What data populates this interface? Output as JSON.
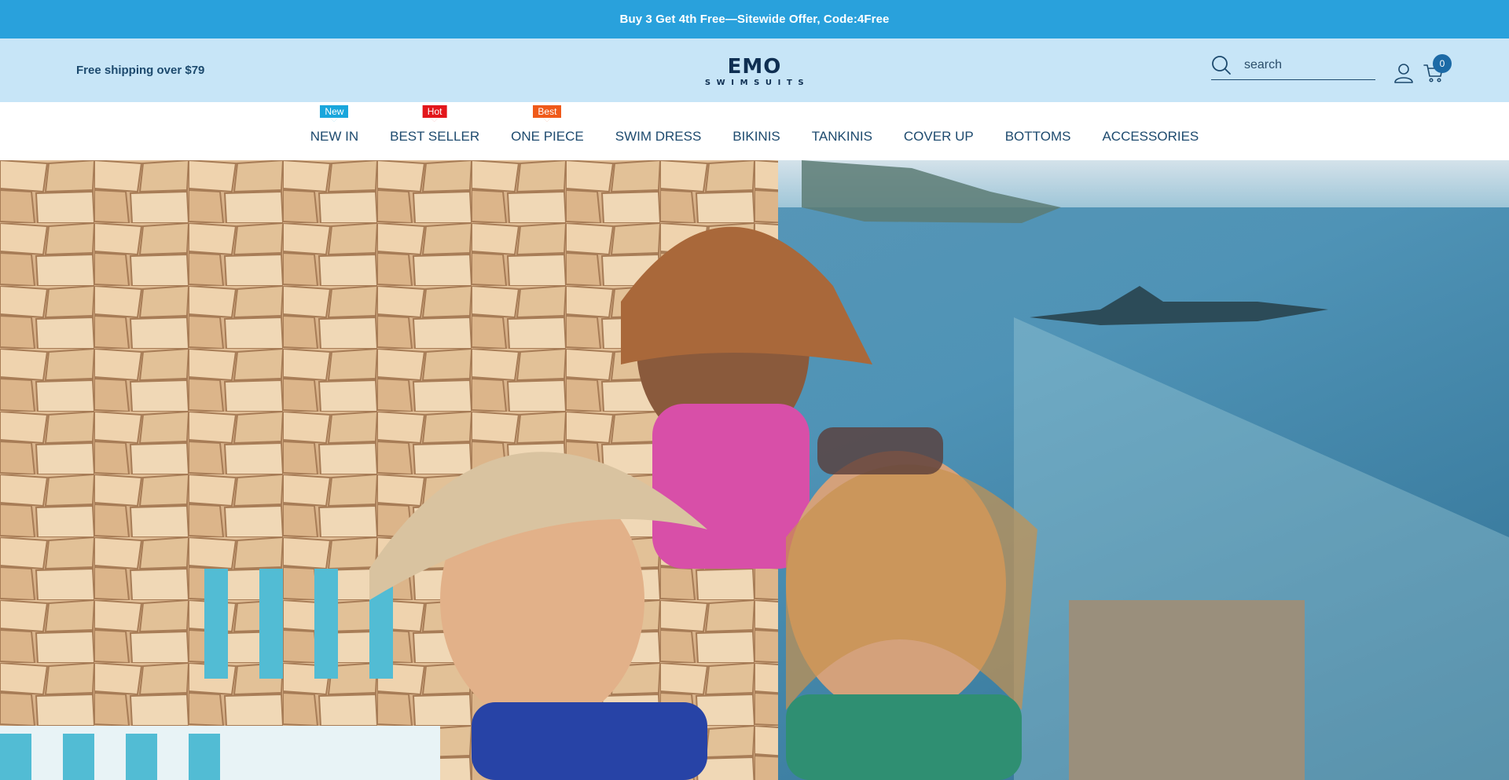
{
  "announcement": {
    "text": "Buy 3 Get 4th Free—Sitewide Offer, Code:4Free"
  },
  "header": {
    "shipping_note": "Free shipping over $79",
    "logo": {
      "main": "EMO",
      "sub": "SWIMSUITS"
    },
    "search": {
      "placeholder": "search"
    },
    "cart": {
      "count": "0"
    }
  },
  "nav": {
    "items": [
      {
        "label": "NEW IN",
        "tag": "New",
        "tag_color": "#19a6dc"
      },
      {
        "label": "BEST SELLER",
        "tag": "Hot",
        "tag_color": "#e3161b"
      },
      {
        "label": "ONE PIECE",
        "tag": "Best",
        "tag_color": "#ef5a1a"
      },
      {
        "label": "SWIM DRESS"
      },
      {
        "label": "BIKINIS"
      },
      {
        "label": "TANKINIS"
      },
      {
        "label": "COVER UP"
      },
      {
        "label": "BOTTOMS"
      },
      {
        "label": "ACCESSORIES"
      }
    ]
  },
  "colors": {
    "announcement_bg": "#29a1dc",
    "header_bg": "#c7e5f7",
    "nav_text": "#1d4a6e",
    "brand_dark": "#0f2f52"
  }
}
